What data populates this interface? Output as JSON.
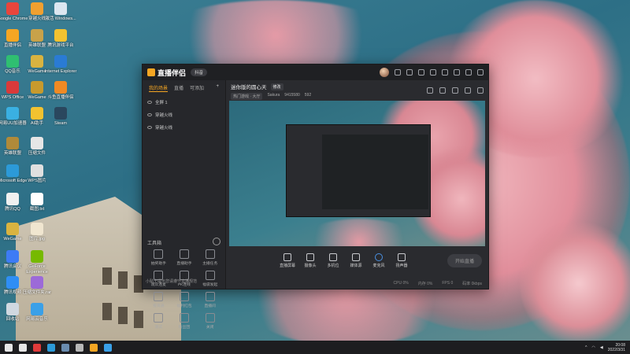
{
  "desktop": {
    "icons": [
      {
        "label": "Google Chrome",
        "color": "#e8453c"
      },
      {
        "label": "穿越火线",
        "color": "#f0a030"
      },
      {
        "label": "激活 Windows...",
        "color": "#dce6f0"
      },
      {
        "label": "直播伴侣",
        "color": "#f5a623"
      },
      {
        "label": "英雄联盟",
        "color": "#c8a24a"
      },
      {
        "label": "腾讯游戏平台",
        "color": "#f2c230"
      },
      {
        "label": "QQ音乐",
        "color": "#2fbf71"
      },
      {
        "label": "WeGame",
        "color": "#d9b340"
      },
      {
        "label": "Internet Explorer",
        "color": "#2a7bd4"
      },
      {
        "label": "WPS Office",
        "color": "#d93a3a"
      },
      {
        "label": "WeGame",
        "color": "#c79a2d"
      },
      {
        "label": "斗鱼直播伴侣",
        "color": "#f08a24"
      },
      {
        "label": "网易UU加速器",
        "color": "#3ab0e2"
      },
      {
        "label": "AI助手",
        "color": "#f2c230"
      },
      {
        "label": "Steam",
        "color": "#2a475e"
      },
      {
        "label": "英雄联盟",
        "color": "#b08a3a"
      },
      {
        "label": "压缩文件",
        "color": "#e6e6e6"
      },
      {
        "label": "Microsoft Edge",
        "color": "#2c9ad8"
      },
      {
        "label": "WPS图片",
        "color": "#e0e0e0"
      },
      {
        "label": "腾讯QQ",
        "color": "#f0f0f0"
      },
      {
        "label": "截图.txt",
        "color": "#ffffff"
      },
      {
        "label": "WeGame",
        "color": "#d9b340"
      },
      {
        "label": "图片.jpg",
        "color": "#f0e6d0"
      },
      {
        "label": "腾讯会议",
        "color": "#3d7bf5"
      },
      {
        "label": "GeForce Experience",
        "color": "#76b900"
      },
      {
        "label": "腾讯视频",
        "color": "#2f8ef5"
      },
      {
        "label": "压缩文件夹.rar",
        "color": "#9c6ad8"
      },
      {
        "label": "回收站",
        "color": "#d0d8e0"
      },
      {
        "label": "网易云音乐",
        "color": "#3aa0e8"
      }
    ]
  },
  "app": {
    "logo": "直播伴侣",
    "version": "抖音",
    "tabs": [
      "我的场景",
      "直播",
      "可添加"
    ],
    "scenes": [
      "全屏 1",
      "穿越火线",
      "穿越火线"
    ],
    "room_title": "迷你版的圆心天",
    "room_tag": "修改",
    "room_category": "热门游戏 · 大厅",
    "room_user": "Sakura",
    "room_id": "9415580",
    "room_fans": "592",
    "tools_header": "工具箱",
    "tools": [
      "抽奖助手",
      "直播助手",
      "主播任务",
      "观众连麦",
      "PK连线",
      "福袋发起",
      "投资通",
      "福利红包",
      "直播间",
      "测试",
      "粉丝团",
      "关闭"
    ],
    "footer_notice": "小贴士提示您请遵守直播规范",
    "toolbar": [
      {
        "label": "直播屏幕",
        "icon": "screen-icon"
      },
      {
        "label": "摄像头",
        "icon": "camera-icon"
      },
      {
        "label": "多机位",
        "icon": "multicam-icon"
      },
      {
        "label": "媒体源",
        "icon": "media-icon"
      },
      {
        "label": "麦克风",
        "icon": "mic-icon"
      },
      {
        "label": "扬声器",
        "icon": "speaker-icon"
      }
    ],
    "start_button": "开始直播",
    "status": [
      "CPU 0%",
      "内存 0%",
      "FPS 0",
      "码率 0kbps"
    ]
  },
  "taskbar": {
    "time": "20:08",
    "date": "2022/3/31",
    "apps": [
      {
        "name": "windows-start-icon",
        "color": "#e6e6e6"
      },
      {
        "name": "search-icon",
        "color": "#e6e6e6"
      },
      {
        "name": "music-app-icon",
        "color": "#e03a3a"
      },
      {
        "name": "edge-app-icon",
        "color": "#2c9ad8"
      },
      {
        "name": "steam-app-icon",
        "color": "#6a8caf"
      },
      {
        "name": "game-app-icon",
        "color": "#b8b8b8"
      },
      {
        "name": "live-app-icon",
        "color": "#f5a623"
      },
      {
        "name": "chrome-app-icon",
        "color": "#3aa0e8"
      }
    ]
  }
}
